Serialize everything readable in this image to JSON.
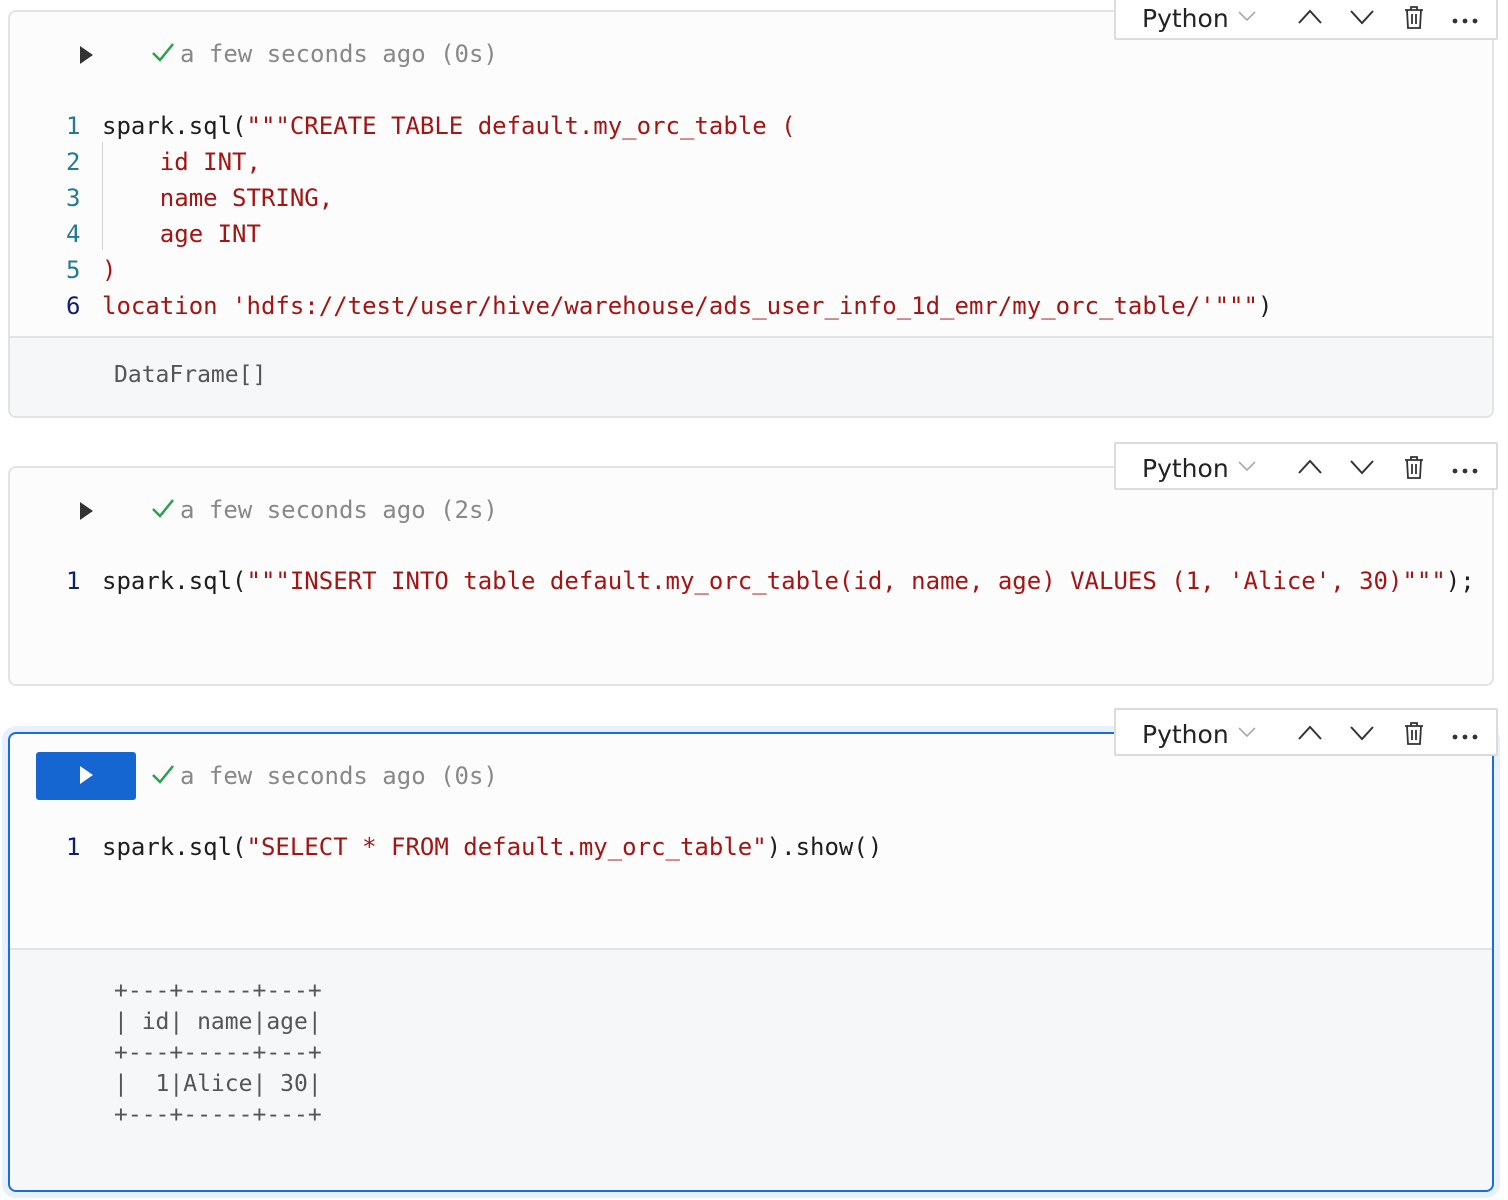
{
  "cells": [
    {
      "language": "Python",
      "status": "a few seconds ago (0s)",
      "code_lines": [
        {
          "num": "1",
          "prefix": "spark.sql(",
          "str": "\"\"\"CREATE TABLE default.my_orc_table (",
          "suffix": ""
        },
        {
          "num": "2",
          "prefix": "",
          "str": "    id INT,",
          "suffix": ""
        },
        {
          "num": "3",
          "prefix": "",
          "str": "    name STRING,",
          "suffix": ""
        },
        {
          "num": "4",
          "prefix": "",
          "str": "    age INT",
          "suffix": ""
        },
        {
          "num": "5",
          "prefix": "",
          "str": ")",
          "suffix": ""
        },
        {
          "num": "6",
          "prefix": "",
          "str": "location 'hdfs://test/user/hive/warehouse/ads_user_info_1d_emr/my_orc_table/'\"\"\"",
          "suffix": ")"
        }
      ],
      "output": "DataFrame[]"
    },
    {
      "language": "Python",
      "status": "a few seconds ago (2s)",
      "code_lines": [
        {
          "num": "1",
          "prefix": "spark.sql(",
          "str": "\"\"\"INSERT INTO table default.my_orc_table(id, name, age) VALUES (1, 'Alice', 30)\"\"\"",
          "suffix": ");"
        }
      ]
    },
    {
      "language": "Python",
      "status": "a few seconds ago (0s)",
      "code_lines": [
        {
          "num": "1",
          "prefix": "spark.sql(",
          "str": "\"SELECT * FROM default.my_orc_table\"",
          "suffix": ").show()"
        }
      ],
      "output": "+---+-----+---+\n| id| name|age|\n+---+-----+---+\n|  1|Alice| 30|\n+---+-----+---+"
    }
  ],
  "colors": {
    "accent": "#1666d2",
    "string": "#a31515",
    "check": "#2e9e4f",
    "line_number": "#237893"
  }
}
